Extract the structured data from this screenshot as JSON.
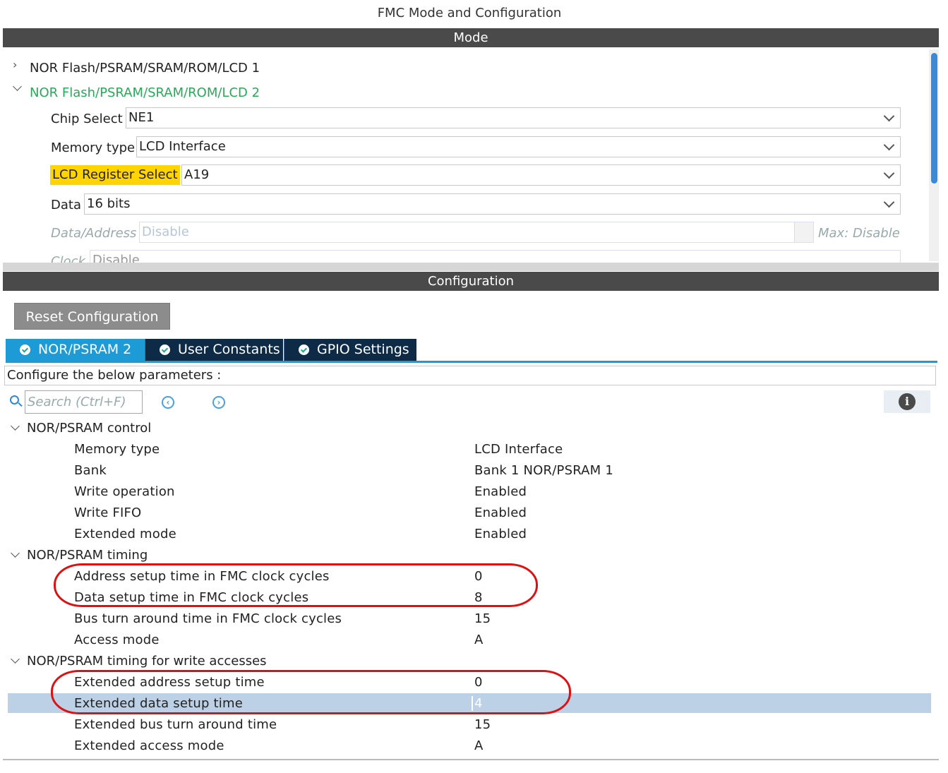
{
  "window": {
    "title": "FMC Mode and Configuration"
  },
  "mode": {
    "header": "Mode",
    "tree": [
      {
        "label": "NOR Flash/PSRAM/SRAM/ROM/LCD 1",
        "expanded": false
      },
      {
        "label": "NOR Flash/PSRAM/SRAM/ROM/LCD 2",
        "expanded": true
      }
    ],
    "fields": {
      "chip_select": {
        "label": "Chip Select",
        "value": "NE1"
      },
      "memory_type": {
        "label": "Memory type",
        "value": "LCD Interface"
      },
      "lcd_register_select": {
        "label": "LCD Register Select",
        "value": "A19"
      },
      "data": {
        "label": "Data",
        "value": "16 bits"
      },
      "data_address": {
        "label": "Data/Address",
        "value": "Disable",
        "max": "Max: Disable"
      },
      "clock": {
        "label": "Clock",
        "value": "Disable"
      }
    }
  },
  "configuration": {
    "header": "Configuration",
    "reset_label": "Reset Configuration",
    "tabs": [
      {
        "label": "NOR/PSRAM 2",
        "active": true
      },
      {
        "label": "User Constants",
        "active": false
      },
      {
        "label": "GPIO Settings",
        "active": false
      }
    ],
    "configure_text": "Configure the below parameters :",
    "search_placeholder": "Search (Ctrl+F)",
    "groups": [
      {
        "label": "NOR/PSRAM control",
        "rows": [
          {
            "key": "Memory type",
            "value": "LCD Interface"
          },
          {
            "key": "Bank",
            "value": "Bank 1 NOR/PSRAM 1"
          },
          {
            "key": "Write operation",
            "value": "Enabled"
          },
          {
            "key": "Write FIFO",
            "value": "Enabled"
          },
          {
            "key": "Extended mode",
            "value": "Enabled"
          }
        ]
      },
      {
        "label": "NOR/PSRAM timing",
        "rows": [
          {
            "key": "Address setup time in FMC clock cycles",
            "value": "0"
          },
          {
            "key": "Data setup time in FMC clock cycles",
            "value": "8"
          },
          {
            "key": "Bus turn around time in FMC clock cycles",
            "value": "15"
          },
          {
            "key": "Access mode",
            "value": "A"
          }
        ]
      },
      {
        "label": "NOR/PSRAM timing for write accesses",
        "rows": [
          {
            "key": "Extended address setup time",
            "value": "0"
          },
          {
            "key": "Extended data setup time",
            "value": "4",
            "selected": true
          },
          {
            "key": "Extended bus turn around time",
            "value": "15"
          },
          {
            "key": "Extended access mode",
            "value": "A"
          }
        ]
      }
    ]
  },
  "colors": {
    "header_bar": "#4a4a4a",
    "tab_active": "#1c9bd7",
    "tab_inactive": "#0d2a47",
    "highlight_yellow": "#ffd400",
    "annotation_red": "#dd1111",
    "selected_row": "#bcd0e6"
  }
}
